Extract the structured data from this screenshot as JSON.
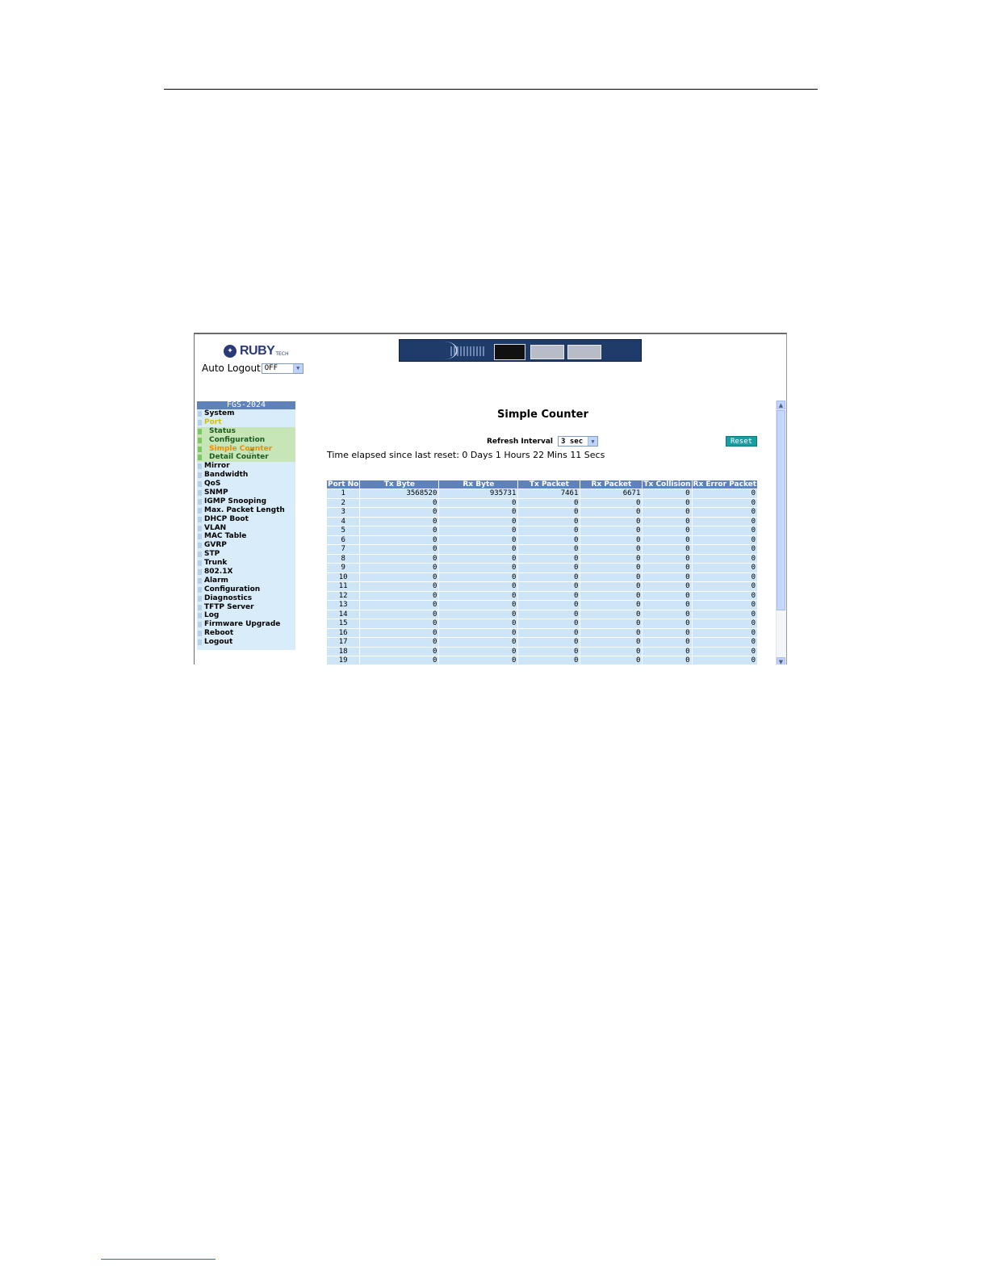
{
  "brand": {
    "name": "RUBY",
    "suffix": "TECH"
  },
  "auto_logout": {
    "label": "Auto Logout",
    "value": "OFF"
  },
  "sidebar": {
    "title": "FGS-2024",
    "items": [
      {
        "label": "System"
      },
      {
        "label": "Port"
      },
      {
        "label": "Status"
      },
      {
        "label": "Configuration"
      },
      {
        "label": "Simple Counter"
      },
      {
        "label": "Detail Counter"
      },
      {
        "label": "Mirror"
      },
      {
        "label": "Bandwidth"
      },
      {
        "label": "QoS"
      },
      {
        "label": "SNMP"
      },
      {
        "label": "IGMP Snooping"
      },
      {
        "label": "Max. Packet Length"
      },
      {
        "label": "DHCP Boot"
      },
      {
        "label": "VLAN"
      },
      {
        "label": "MAC Table"
      },
      {
        "label": "GVRP"
      },
      {
        "label": "STP"
      },
      {
        "label": "Trunk"
      },
      {
        "label": "802.1X"
      },
      {
        "label": "Alarm"
      },
      {
        "label": "Configuration"
      },
      {
        "label": "Diagnostics"
      },
      {
        "label": "TFTP Server"
      },
      {
        "label": "Log"
      },
      {
        "label": "Firmware Upgrade"
      },
      {
        "label": "Reboot"
      },
      {
        "label": "Logout"
      }
    ]
  },
  "main": {
    "title": "Simple Counter",
    "refresh_label": "Refresh Interval",
    "refresh_value": "3 sec",
    "reset_label": "Reset",
    "elapsed": "Time elapsed since last reset: 0 Days 1 Hours 22 Mins 11 Secs",
    "table": {
      "headers": [
        "Port No",
        "Tx Byte",
        "Rx Byte",
        "Tx Packet",
        "Rx Packet",
        "Tx Collision",
        "Rx Error Packet"
      ],
      "rows": [
        [
          "1",
          "3568520",
          "935731",
          "7461",
          "6671",
          "0",
          "0"
        ],
        [
          "2",
          "0",
          "0",
          "0",
          "0",
          "0",
          "0"
        ],
        [
          "3",
          "0",
          "0",
          "0",
          "0",
          "0",
          "0"
        ],
        [
          "4",
          "0",
          "0",
          "0",
          "0",
          "0",
          "0"
        ],
        [
          "5",
          "0",
          "0",
          "0",
          "0",
          "0",
          "0"
        ],
        [
          "6",
          "0",
          "0",
          "0",
          "0",
          "0",
          "0"
        ],
        [
          "7",
          "0",
          "0",
          "0",
          "0",
          "0",
          "0"
        ],
        [
          "8",
          "0",
          "0",
          "0",
          "0",
          "0",
          "0"
        ],
        [
          "9",
          "0",
          "0",
          "0",
          "0",
          "0",
          "0"
        ],
        [
          "10",
          "0",
          "0",
          "0",
          "0",
          "0",
          "0"
        ],
        [
          "11",
          "0",
          "0",
          "0",
          "0",
          "0",
          "0"
        ],
        [
          "12",
          "0",
          "0",
          "0",
          "0",
          "0",
          "0"
        ],
        [
          "13",
          "0",
          "0",
          "0",
          "0",
          "0",
          "0"
        ],
        [
          "14",
          "0",
          "0",
          "0",
          "0",
          "0",
          "0"
        ],
        [
          "15",
          "0",
          "0",
          "0",
          "0",
          "0",
          "0"
        ],
        [
          "16",
          "0",
          "0",
          "0",
          "0",
          "0",
          "0"
        ],
        [
          "17",
          "0",
          "0",
          "0",
          "0",
          "0",
          "0"
        ],
        [
          "18",
          "0",
          "0",
          "0",
          "0",
          "0",
          "0"
        ],
        [
          "19",
          "0",
          "0",
          "0",
          "0",
          "0",
          "0"
        ]
      ]
    }
  },
  "colors": {
    "header_blue": "#5f82b8",
    "cell_blue": "#cde5f7",
    "reset_teal": "#16a0a4",
    "selected_orange": "#f08a00"
  },
  "icons": {
    "dropdown": "chevron-down-icon",
    "scroll_up": "arrow-up-icon",
    "scroll_down": "arrow-down-icon",
    "cursor": "hand-cursor-icon",
    "logo": "ruby-logo-icon"
  }
}
